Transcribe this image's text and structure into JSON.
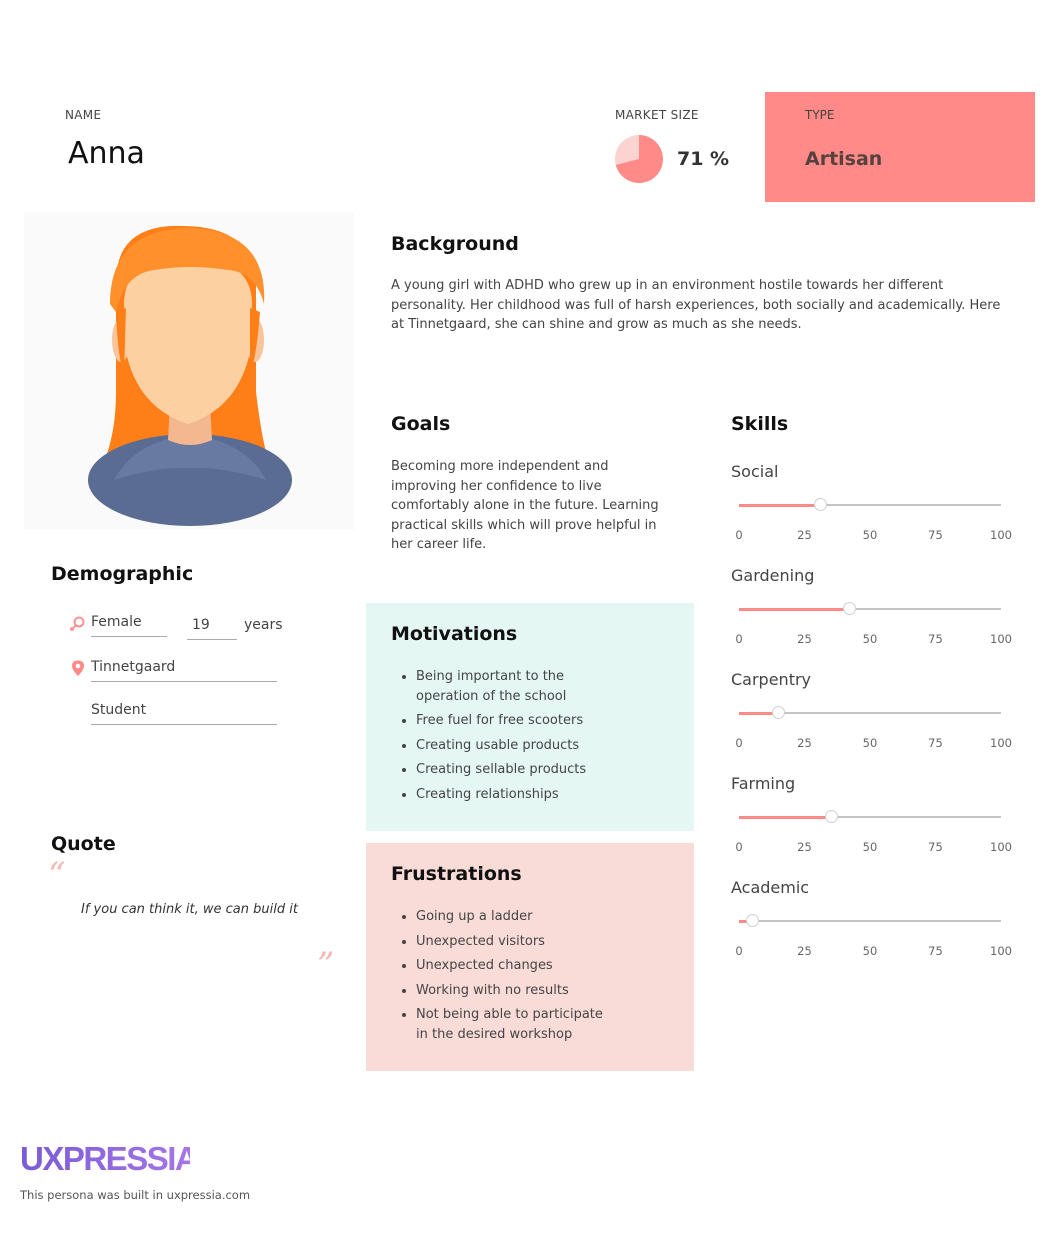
{
  "header": {
    "name_label": "NAME",
    "name": "Anna",
    "market_label": "MARKET SIZE",
    "market_value": "71 %",
    "market_fraction": 0.71,
    "type_label": "TYPE",
    "type": "Artisan"
  },
  "colors": {
    "accent": "#ff8a87",
    "motivations_bg": "#e5f7f3",
    "frustrations_bg": "#f9dcd8"
  },
  "background": {
    "heading": "Background",
    "text": "A young girl with ADHD who grew up in an environment hostile towards her different personality. Her childhood was full of harsh experiences, both socially and academically. Here at Tinnetgaard, she can shine and grow as much as she needs."
  },
  "goals": {
    "heading": "Goals",
    "text": "Becoming more independent and improving her confidence to live comfortably alone in the future. Learning practical skills which will prove helpful in her career life."
  },
  "demographic": {
    "heading": "Demographic",
    "gender": "Female",
    "age": "19",
    "age_unit": "years",
    "location": "Tinnetgaard",
    "occupation": "Student",
    "gender_icon": "gender-female-icon",
    "location_icon": "location-pin-icon"
  },
  "quote": {
    "heading": "Quote",
    "open_mark": "“",
    "close_mark": "”",
    "text": "If you can think it, we can build it"
  },
  "motivations": {
    "heading": "Motivations",
    "items": [
      "Being important to the operation of the school",
      "Free fuel for free scooters",
      "Creating usable products",
      "Creating sellable products",
      "Creating relationships"
    ]
  },
  "frustrations": {
    "heading": "Frustrations",
    "items": [
      "Going up a ladder",
      "Unexpected visitors",
      "Unexpected changes",
      "Working with no results",
      "Not being able to participate in the desired workshop"
    ]
  },
  "skills": {
    "heading": "Skills",
    "ticks": [
      "0",
      "25",
      "50",
      "75",
      "100"
    ],
    "items": [
      {
        "label": "Social",
        "value": 31
      },
      {
        "label": "Gardening",
        "value": 42
      },
      {
        "label": "Carpentry",
        "value": 15
      },
      {
        "label": "Farming",
        "value": 35
      },
      {
        "label": "Academic",
        "value": 5
      }
    ]
  },
  "footer": {
    "logo": "UXPRESSIA",
    "text": "This persona was built in uxpressia.com"
  }
}
